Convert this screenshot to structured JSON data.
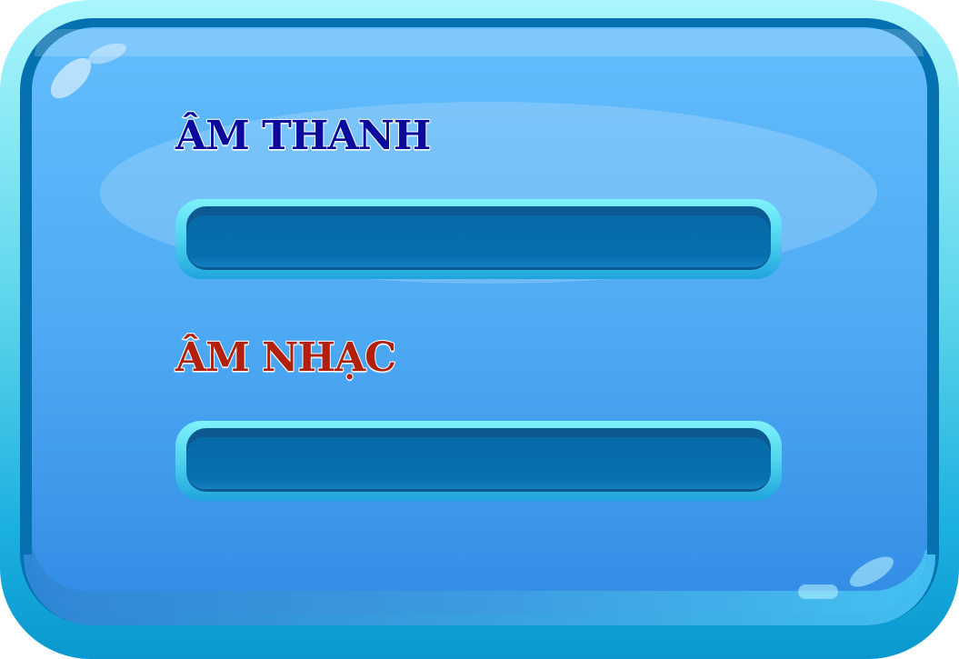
{
  "settings": {
    "sound": {
      "label": "ÂM THANH",
      "label_color": "#0a0a9c",
      "level": 0
    },
    "music": {
      "label": "ÂM NHẠC",
      "label_color": "#b0200c",
      "level": 0
    }
  },
  "colors": {
    "frame_light": "#a9f6fc",
    "frame_dark": "#0571b0",
    "panel_face": "#4aa7f2",
    "track": "#0670ae",
    "track_rim": "#4fd3ef"
  }
}
